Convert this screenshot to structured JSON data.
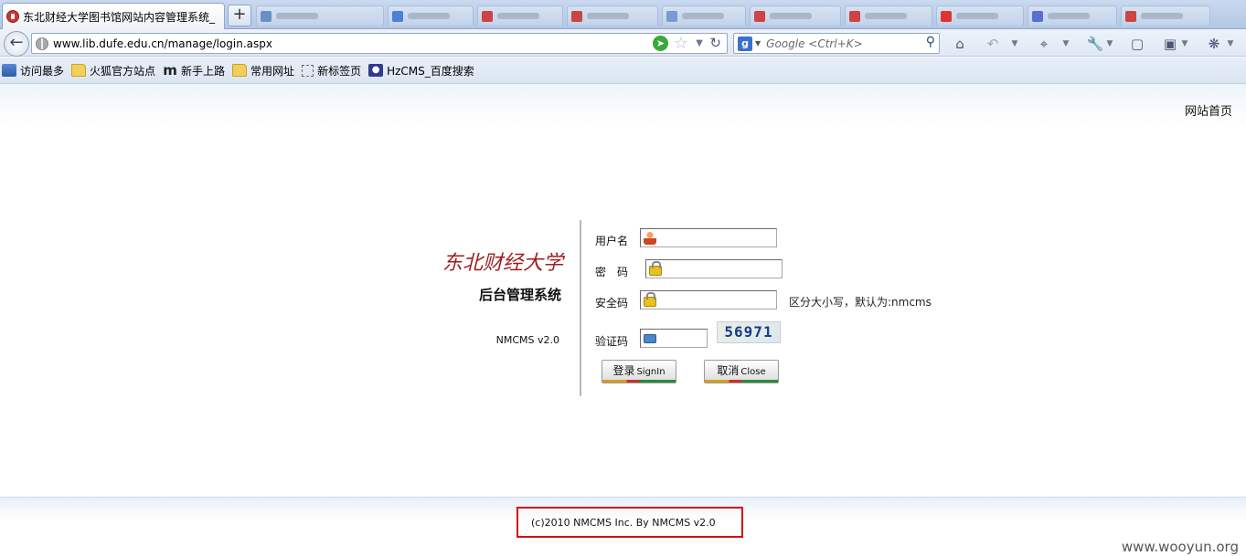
{
  "browser": {
    "active_tab_title": "东北财经大学图书馆网站内容管理系统_",
    "new_tab_label": "+",
    "url": "www.lib.dufe.edu.cn/manage/login.aspx",
    "search_placeholder": "Google <Ctrl+K>",
    "bookmarks": [
      {
        "label": "访问最多",
        "icon": "visit-icon"
      },
      {
        "label": "火狐官方站点",
        "icon": "folder-icon"
      },
      {
        "label": "新手上路",
        "icon": "m-icon"
      },
      {
        "label": "常用网址",
        "icon": "folder-icon"
      },
      {
        "label": "新标签页",
        "icon": "dashed-page-icon"
      },
      {
        "label": "HzCMS_百度搜索",
        "icon": "paw-icon"
      }
    ]
  },
  "page": {
    "home_link": "网站首页",
    "brand_title": "东北财经大学",
    "brand_subtitle": "后台管理系统",
    "version": "NMCMS v2.0",
    "form": {
      "username_label": "用户名",
      "password_label": "密　码",
      "security_label": "安全码",
      "security_hint": "区分大小写，默认为:nmcms",
      "captcha_label": "验证码",
      "captcha_text": "56971",
      "login_button": "登录",
      "login_button_en": "SignIn",
      "close_button": "取消",
      "close_button_en": "Close"
    },
    "copyright": "(c)2010 NMCMS Inc. By NMCMS v2.0",
    "watermark": "www.wooyun.org"
  },
  "colors": {
    "brand_red": "#9e1e1e",
    "highlight_red": "#d01010"
  }
}
